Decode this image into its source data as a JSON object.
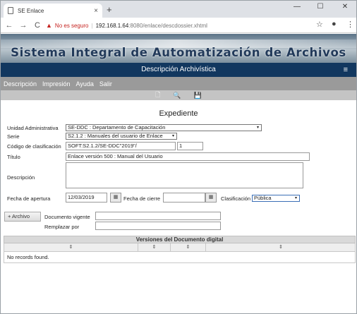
{
  "browser": {
    "tab_title": "SE Enlace",
    "new_tab": "+",
    "tab_close": "×",
    "back": "←",
    "forward": "→",
    "reload": "C",
    "warn_icon": "▲",
    "insecure_label": "No es seguro",
    "url_host": "192.168.1.64",
    "url_rest": ":8080/enlace/descdossier.xhtml",
    "star": "☆",
    "account": "●",
    "menu_dots": "⋮",
    "minimize": "—",
    "maximize": "☐",
    "close": "✕"
  },
  "banner": {
    "title": "Sistema Integral de Automatización de Archivos"
  },
  "header": {
    "title": "Descripción Archivística",
    "menu_icon": "≡"
  },
  "menu": {
    "items": [
      "Descripción",
      "Impresión",
      "Ayuda",
      "Salir"
    ]
  },
  "toolbar": {
    "new_icon": "🗋",
    "search_icon": "🔍",
    "save_icon": "💾"
  },
  "form": {
    "title": "Expediente",
    "unidad_label": "Unidad Administrativa",
    "unidad_value": "SE-DDC : Departamento de Capacitación",
    "serie_label": "Serie",
    "serie_value": "S2.1.2 : Manuales del usuario de Enlace",
    "codigo_label": "Código de clasificación",
    "codigo_value": "SOFT:S2.1.2/SE-DDC\"2019\"/",
    "codigo_num": "1",
    "titulo_label": "Título",
    "titulo_value": "Enlace versión 500 : Manual del Usuario",
    "descripcion_label": "Descripción",
    "descripcion_value": "",
    "apertura_label": "Fecha de apertura",
    "apertura_value": "12/03/2019",
    "cierre_label": "Fecha de cierre",
    "cierre_value": "",
    "clasificacion_label": "Clasificación",
    "clasificacion_value": "Pública",
    "calendar_icon": "▦",
    "caret": "▾",
    "archivo_button": "+ Archivo",
    "doc_vigente_label": "Documento vigente",
    "doc_vigente_value": "",
    "reemplazar_label": "Remplazar por",
    "reemplazar_value": ""
  },
  "table": {
    "title": "Versiones del Documento digital",
    "sort_icon": "⇕",
    "empty_message": "No records found."
  }
}
